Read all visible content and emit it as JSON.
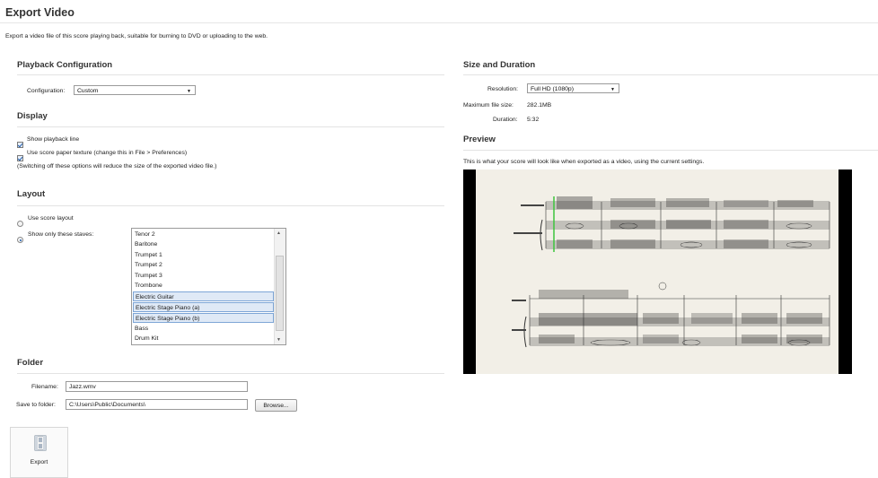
{
  "header": {
    "title": "Export Video",
    "subtitle": "Export a video file of this score playing back, suitable for burning to DVD or uploading to the web."
  },
  "playback": {
    "heading": "Playback Configuration",
    "config_label": "Configuration:",
    "config_value": "Custom"
  },
  "display": {
    "heading": "Display",
    "show_playback_line": "Show playback line",
    "use_paper_texture": "Use score paper texture (change this in File > Preferences)",
    "note": "(Switching off these options will reduce the size of the exported video file.)"
  },
  "layout": {
    "heading": "Layout",
    "use_score_layout": "Use score layout",
    "show_only_staves": "Show only these staves:",
    "staves": [
      {
        "name": "Tenor 2",
        "selected": false
      },
      {
        "name": "Baritone",
        "selected": false
      },
      {
        "name": "Trumpet 1",
        "selected": false
      },
      {
        "name": "Trumpet 2",
        "selected": false
      },
      {
        "name": "Trumpet 3",
        "selected": false
      },
      {
        "name": "Trombone",
        "selected": false
      },
      {
        "name": "Electric Guitar",
        "selected": true
      },
      {
        "name": "Electric Stage Piano (a)",
        "selected": true
      },
      {
        "name": "Electric Stage Piano (b)",
        "selected": true
      },
      {
        "name": "Bass",
        "selected": false
      },
      {
        "name": "Drum Kit",
        "selected": false
      }
    ]
  },
  "folder": {
    "heading": "Folder",
    "filename_label": "Filename:",
    "filename_value": "Jazz.wmv",
    "save_label": "Save to folder:",
    "save_value": "C:\\Users\\Public\\Documents\\",
    "browse_label": "Browse..."
  },
  "export": {
    "label": "Export",
    "icon": "film-icon"
  },
  "size": {
    "heading": "Size and Duration",
    "resolution_label": "Resolution:",
    "resolution_value": "Full HD (1080p)",
    "max_size_label": "Maximum file size:",
    "max_size_value": "282.1MB",
    "duration_label": "Duration:",
    "duration_value": "5:32"
  },
  "preview": {
    "heading": "Preview",
    "description": "This is what your score will look like when exported as a video, using the current settings."
  },
  "colors": {
    "selection_fill": "#dfe9f6",
    "selection_border": "#7ea6d6",
    "playback_line": "#3cc43c",
    "paper": "#f2efe7"
  }
}
